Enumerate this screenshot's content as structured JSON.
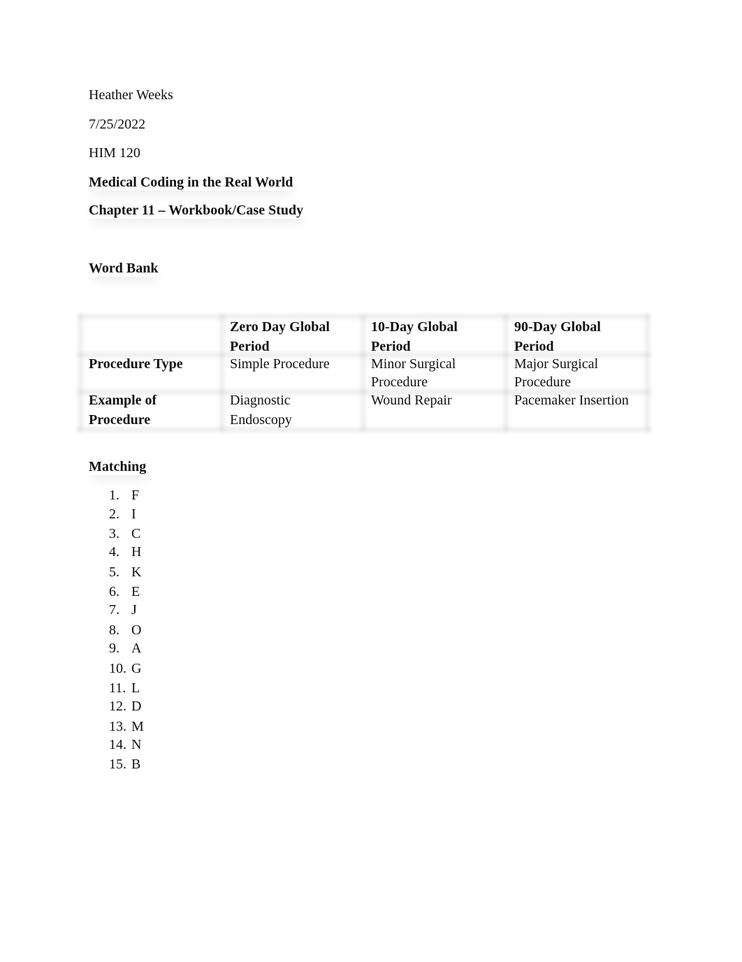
{
  "header": {
    "author": "Heather Weeks",
    "date": "7/25/2022",
    "course": "HIM 120",
    "book_title": "Medical Coding in the Real World",
    "chapter_title": "Chapter 11 – Workbook/Case Study"
  },
  "word_bank": {
    "heading": "Word Bank",
    "columns": [
      "",
      "Zero Day Global Period",
      "10-Day Global Period",
      "90-Day Global Period"
    ],
    "column_lines": [
      [],
      [
        "Zero Day Global",
        "Period"
      ],
      [
        "10-Day Global",
        "Period"
      ],
      [
        "90-Day Global",
        "Period"
      ]
    ],
    "rows": [
      {
        "label": "Procedure Type",
        "label_lines": [
          "Procedure Type"
        ],
        "cells": [
          [
            "Simple Procedure"
          ],
          [
            "Minor Surgical",
            "Procedure"
          ],
          [
            "Major Surgical",
            "Procedure"
          ]
        ]
      },
      {
        "label": "Example of Procedure",
        "label_lines": [
          "Example of",
          "Procedure"
        ],
        "cells": [
          [
            "Diagnostic",
            "Endoscopy"
          ],
          [
            "Wound Repair"
          ],
          [
            "Pacemaker Insertion"
          ]
        ]
      }
    ]
  },
  "matching": {
    "heading": "Matching",
    "items": [
      {
        "num": "1.",
        "answer": "F"
      },
      {
        "num": "2.",
        "answer": "I"
      },
      {
        "num": "3.",
        "answer": "C"
      },
      {
        "num": "4.",
        "answer": "H"
      },
      {
        "num": "5.",
        "answer": "K"
      },
      {
        "num": "6.",
        "answer": "E"
      },
      {
        "num": "7.",
        "answer": "J"
      },
      {
        "num": "8.",
        "answer": "O"
      },
      {
        "num": "9.",
        "answer": "A"
      },
      {
        "num": "10.",
        "answer": "G"
      },
      {
        "num": "11.",
        "answer": "L"
      },
      {
        "num": "12.",
        "answer": "D"
      },
      {
        "num": "13.",
        "answer": "M"
      },
      {
        "num": "14.",
        "answer": "N"
      },
      {
        "num": "15.",
        "answer": "B"
      }
    ]
  }
}
